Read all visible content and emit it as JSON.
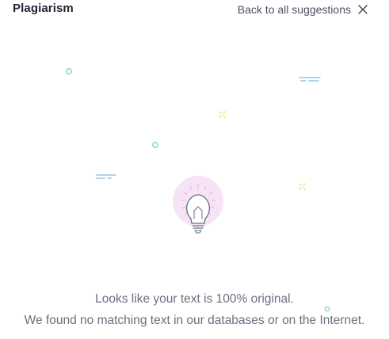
{
  "header": {
    "title": "Plagiarism",
    "back_label": "Back to all suggestions"
  },
  "icons": {
    "close": "close-icon",
    "illustration": "lightbulb-icon",
    "decor": [
      "ring-icon",
      "dash-icon",
      "sparkle-icon"
    ]
  },
  "colors": {
    "ring": "#7fd8c6",
    "dash": "#8ec5f0",
    "sparkle": "#f2d77e",
    "bulb_glow": "#f6e4f6",
    "bulb_stroke": "#6b7080"
  },
  "result": {
    "line1": "Looks like your text is 100% original.",
    "line2": "We found no matching text in our databases or on the Internet."
  }
}
